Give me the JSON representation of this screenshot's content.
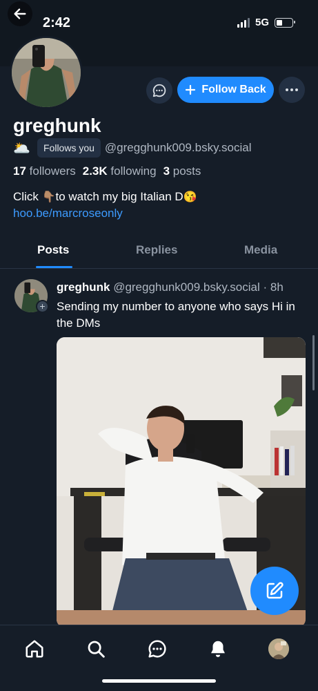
{
  "status_bar": {
    "time": "2:42",
    "network": "5G"
  },
  "profile": {
    "display_name": "greghunk",
    "sun_emoji": "🌥️",
    "follows_you": "Follows you",
    "handle": "@gregghunk009.bsky.social",
    "stats": {
      "followers_count": "17",
      "followers_label": "followers",
      "following_count": "2.3K",
      "following_label": "following",
      "posts_count": "3",
      "posts_label": "posts"
    },
    "bio_before": "Click ",
    "bio_emoji": "👇🏽",
    "bio_after": "to watch my big Italian D",
    "bio_emoji2": "😘",
    "bio_link": "hoo.be/marcroseonly"
  },
  "actions": {
    "follow_back": "Follow Back"
  },
  "tabs": [
    {
      "label": "Posts",
      "active": true
    },
    {
      "label": "Replies",
      "active": false
    },
    {
      "label": "Media",
      "active": false
    }
  ],
  "post": {
    "author": "greghunk",
    "handle": "@gregghunk009.bsky.social",
    "time": "· 8h",
    "text": "Sending my number to anyone who says Hi in the DMs"
  },
  "icons": {
    "back": "back-arrow-icon",
    "chat": "chat-bubble-icon",
    "more": "more-horizontal-icon",
    "compose": "compose-icon",
    "home": "home-icon",
    "search": "search-icon",
    "messages": "messages-icon",
    "notifications": "bell-icon"
  },
  "colors": {
    "accent": "#208bfe",
    "background": "#151d28",
    "link": "#3d9bff"
  }
}
